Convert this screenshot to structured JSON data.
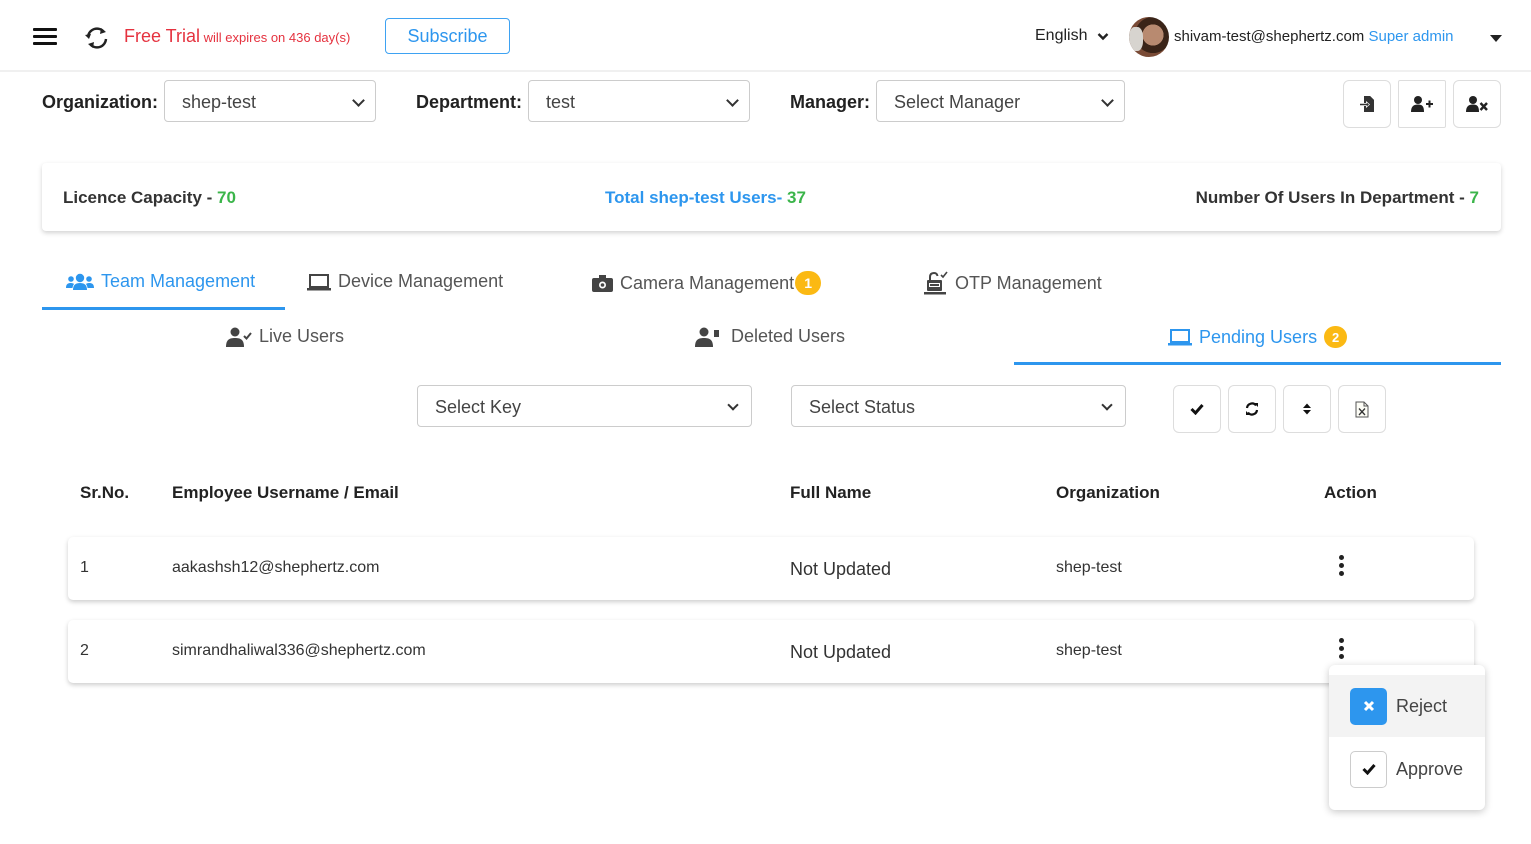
{
  "header": {
    "trial_title": "Free Trial",
    "trial_note": " will expires on 436 day(s)",
    "subscribe_label": "Subscribe",
    "language": "English",
    "user_email": "shivam-test@shephertz.com",
    "user_role": "Super admin"
  },
  "filters": {
    "organization_label": "Organization:",
    "organization_value": "shep-test",
    "department_label": "Department:",
    "department_value": "test",
    "manager_label": "Manager:",
    "manager_placeholder": "Select Manager"
  },
  "toolbar_icons": [
    "import-user-icon",
    "add-user-icon",
    "remove-user-icon"
  ],
  "stats": {
    "licence_label": "Licence Capacity - ",
    "licence_value": "70",
    "total_label": "Total shep-test Users- ",
    "total_value": "37",
    "department_label": "Number Of Users In Department - ",
    "department_value": "7"
  },
  "tabs": [
    {
      "label": "Team Management",
      "icon": "users-icon",
      "active": true
    },
    {
      "label": "Device Management",
      "icon": "laptop-icon"
    },
    {
      "label": "Camera Management",
      "icon": "camera-icon",
      "badge": "1"
    },
    {
      "label": "OTP Management",
      "icon": "otp-lock-icon"
    }
  ],
  "subtabs": [
    {
      "label": "Live Users",
      "icon": "user-check-icon"
    },
    {
      "label": "Deleted Users",
      "icon": "user-deleted-icon"
    },
    {
      "label": "Pending Users",
      "icon": "laptop-icon",
      "badge": "2",
      "active": true
    }
  ],
  "list_filters": {
    "key_placeholder": "Select Key",
    "status_placeholder": "Select Status"
  },
  "list_actions": [
    "check-icon",
    "refresh-icon",
    "sort-icon",
    "excel-export-icon"
  ],
  "table": {
    "columns": [
      "Sr.No.",
      "Employee Username / Email",
      "Full Name",
      "Organization",
      "Action"
    ],
    "rows": [
      {
        "sr": "1",
        "email": "aakashsh12@shephertz.com",
        "full_name": "Not Updated",
        "organization": "shep-test"
      },
      {
        "sr": "2",
        "email": "simrandhaliwal336@shephertz.com",
        "full_name": "Not Updated",
        "organization": "shep-test"
      }
    ]
  },
  "action_menu": {
    "reject_label": "Reject",
    "approve_label": "Approve"
  },
  "colors": {
    "accent": "#2d96ee",
    "trial_red": "#e5323f",
    "stat_green": "#3bb54a",
    "badge_yellow": "#fbb913"
  }
}
